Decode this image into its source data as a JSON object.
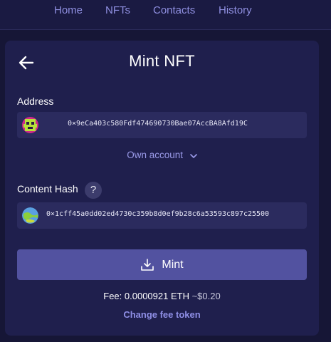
{
  "nav": {
    "items": [
      {
        "label": "Home"
      },
      {
        "label": "NFTs"
      },
      {
        "label": "Contacts"
      },
      {
        "label": "History"
      }
    ]
  },
  "page": {
    "title": "Mint NFT"
  },
  "address": {
    "label": "Address",
    "value": "0×9eCa403c580Fdf474690730Bae07AccBA8Afd19C",
    "avatar_icon": "pixel-avatar-icon"
  },
  "own_account": {
    "label": "Own account",
    "icon": "chevron-down-icon"
  },
  "content_hash": {
    "label": "Content Hash",
    "help": "?",
    "value": "0×1cff45a0dd02ed4730c359b8d0ef9b28c6a53593c897c25500",
    "avatar_icon": "globe-avatar-icon"
  },
  "mint": {
    "label": "Mint",
    "icon": "download-icon"
  },
  "fee": {
    "prefix": "Fee: ",
    "amount": "0.0000921 ETH",
    "usd": "~$0.20",
    "change_label": "Change fee token"
  },
  "colors": {
    "background": "#161636",
    "card": "#1f1f4d",
    "field": "#2b2b5e",
    "accent": "#5252a0",
    "link": "#8f8fe6"
  }
}
